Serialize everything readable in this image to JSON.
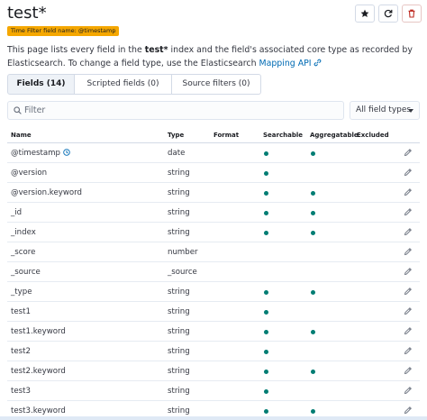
{
  "header": {
    "title": "test*",
    "time_badge": "Time Filter field name: @timestamp"
  },
  "description": {
    "part1": "This page lists every field in the ",
    "index_name": "test*",
    "part2": " index and the field's associated core type as recorded by Elasticsearch. To change a field type, use the Elasticsearch ",
    "link": "Mapping API"
  },
  "tabs": [
    {
      "label": "Fields (14)",
      "active": true
    },
    {
      "label": "Scripted fields (0)",
      "active": false
    },
    {
      "label": "Source filters (0)",
      "active": false
    }
  ],
  "search": {
    "placeholder": "Filter",
    "value": ""
  },
  "type_filter": {
    "label": "All field types"
  },
  "table": {
    "columns": {
      "name": "Name",
      "type": "Type",
      "format": "Format",
      "searchable": "Searchable",
      "aggregatable": "Aggregatable",
      "excluded": "Excluded"
    },
    "rows": [
      {
        "name": "@timestamp",
        "type": "date",
        "searchable": true,
        "aggregatable": true,
        "clock": true
      },
      {
        "name": "@version",
        "type": "string",
        "searchable": true,
        "aggregatable": false
      },
      {
        "name": "@version.keyword",
        "type": "string",
        "searchable": true,
        "aggregatable": true
      },
      {
        "name": "_id",
        "type": "string",
        "searchable": true,
        "aggregatable": true
      },
      {
        "name": "_index",
        "type": "string",
        "searchable": true,
        "aggregatable": true
      },
      {
        "name": "_score",
        "type": "number",
        "searchable": false,
        "aggregatable": false
      },
      {
        "name": "_source",
        "type": "_source",
        "searchable": false,
        "aggregatable": false
      },
      {
        "name": "_type",
        "type": "string",
        "searchable": true,
        "aggregatable": true
      },
      {
        "name": "test1",
        "type": "string",
        "searchable": true,
        "aggregatable": false
      },
      {
        "name": "test1.keyword",
        "type": "string",
        "searchable": true,
        "aggregatable": true
      },
      {
        "name": "test2",
        "type": "string",
        "searchable": true,
        "aggregatable": false
      },
      {
        "name": "test2.keyword",
        "type": "string",
        "searchable": true,
        "aggregatable": true
      },
      {
        "name": "test3",
        "type": "string",
        "searchable": true,
        "aggregatable": false
      },
      {
        "name": "test3.keyword",
        "type": "string",
        "searchable": true,
        "aggregatable": true
      }
    ]
  },
  "icons": {
    "favorite": "star-icon",
    "refresh": "refresh-icon",
    "delete": "trash-icon",
    "search": "search-icon",
    "edit": "pencil-icon",
    "link": "link-icon",
    "time": "clock-icon"
  },
  "colors": {
    "accent": "#006bb4",
    "badge": "#f5a700",
    "dot": "#017d73",
    "danger": "#bd271e"
  }
}
